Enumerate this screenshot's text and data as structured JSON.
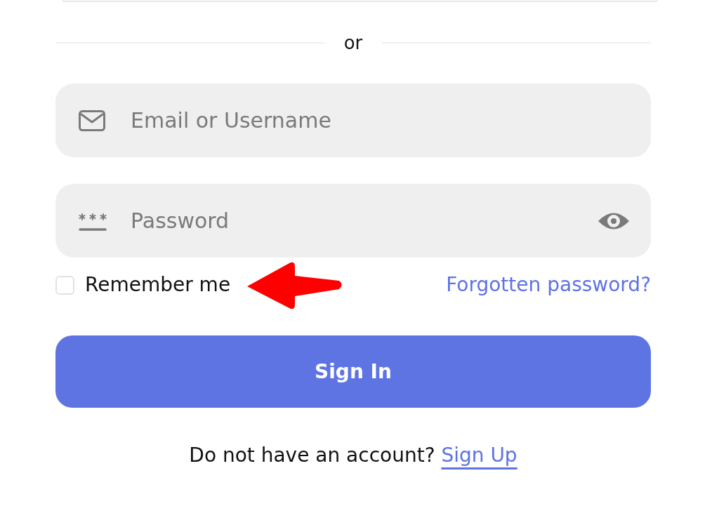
{
  "clipped_button": {
    "kind": "outlined"
  },
  "divider": {
    "label": "or"
  },
  "fields": [
    {
      "kind": "email",
      "placeholder": "Email or Username"
    },
    {
      "kind": "password",
      "placeholder": "Password",
      "reveal_toggle": true
    }
  ],
  "remember_me": {
    "label": "Remember me",
    "checked": false
  },
  "forgot_password_link": "Forgotten password?",
  "submit_button": "Sign In",
  "signup_prompt": {
    "text": "Do not have an account?",
    "link": "Sign Up"
  },
  "annotations": [
    {
      "kind": "arrow"
    }
  ]
}
